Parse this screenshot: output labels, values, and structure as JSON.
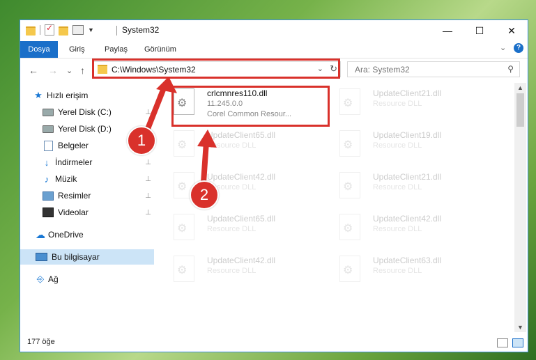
{
  "window": {
    "title": "System32",
    "controls": {
      "minimize": "—",
      "maximize": "☐",
      "close": "✕"
    }
  },
  "ribbon": {
    "tabs": [
      "Dosya",
      "Giriş",
      "Paylaş",
      "Görünüm"
    ],
    "expand_icon": "⌄",
    "help_icon": "?"
  },
  "nav": {
    "back": "←",
    "forward": "→",
    "recent": "⌄",
    "up": "↑",
    "address": "C:\\Windows\\System32",
    "address_dropdown": "⌄",
    "refresh": "↻",
    "search_placeholder": "Ara: System32",
    "search_icon": "⚲"
  },
  "sidebar": {
    "items": [
      {
        "label": "Hızlı erişim",
        "icon": "star-icon",
        "pinned": false
      },
      {
        "label": "Yerel Disk (C:)",
        "icon": "drive-icon",
        "pinned": true
      },
      {
        "label": "Yerel Disk (D:)",
        "icon": "drive-icon",
        "pinned": false
      },
      {
        "label": "Belgeler",
        "icon": "document-icon",
        "pinned": true
      },
      {
        "label": "İndirmeler",
        "icon": "download-icon",
        "pinned": true
      },
      {
        "label": "Müzik",
        "icon": "music-icon",
        "pinned": true
      },
      {
        "label": "Resimler",
        "icon": "pictures-icon",
        "pinned": true
      },
      {
        "label": "Videolar",
        "icon": "video-icon",
        "pinned": true
      },
      {
        "label": "OneDrive",
        "icon": "cloud-icon",
        "pinned": false
      },
      {
        "label": "Bu bilgisayar",
        "icon": "computer-icon",
        "pinned": false,
        "selected": true
      },
      {
        "label": "Ağ",
        "icon": "network-icon",
        "pinned": false
      }
    ],
    "pin_glyph": "📌"
  },
  "files": {
    "highlighted": {
      "name": "crlcmnres110.dll",
      "version": "11.245.0.0",
      "description": "Corel Common Resour..."
    },
    "left_column": [
      {
        "name": "UpdateClient65.dll",
        "type": "Resource DLL"
      },
      {
        "name": "UpdateClient42.dll",
        "type": "Resource DLL"
      },
      {
        "name": "UpdateClient65.dll",
        "type": "Resource DLL"
      },
      {
        "name": "UpdateClient42.dll",
        "type": "Resource DLL"
      }
    ],
    "right_column": [
      {
        "name": "UpdateClient21.dll",
        "type": "Resource DLL"
      },
      {
        "name": "UpdateClient19.dll",
        "type": "Resource DLL"
      },
      {
        "name": "UpdateClient21.dll",
        "type": "Resource DLL"
      },
      {
        "name": "UpdateClient42.dll",
        "type": "Resource DLL"
      },
      {
        "name": "UpdateClient63.dll",
        "type": "Resource DLL"
      }
    ]
  },
  "status": {
    "item_count": "177 öğe"
  },
  "annotations": {
    "badge1": "1",
    "badge2": "2",
    "color": "#d9312b"
  }
}
